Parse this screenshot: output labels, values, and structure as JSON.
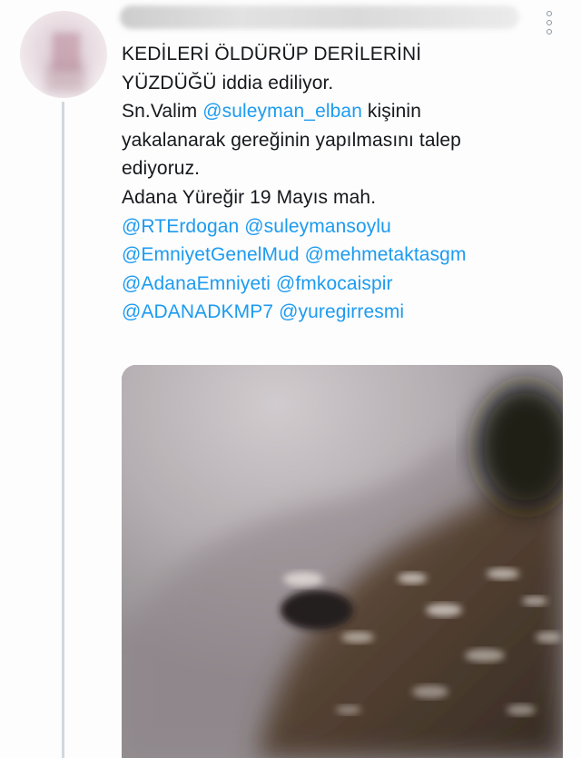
{
  "tweet": {
    "body_lines": [
      {
        "segments": [
          {
            "text": "KEDİLERİ ÖLDÜRÜP DERİLERİNİ",
            "mention": false
          }
        ]
      },
      {
        "segments": [
          {
            "text": "YÜZDÜĞÜ iddia ediliyor.",
            "mention": false
          }
        ]
      },
      {
        "segments": [
          {
            "text": "Sn.Valim ",
            "mention": false
          },
          {
            "text": "@suleyman_elban",
            "mention": true
          },
          {
            "text": " kişinin",
            "mention": false
          }
        ]
      },
      {
        "segments": [
          {
            "text": "yakalanarak gereğinin yapılmasını talep",
            "mention": false
          }
        ]
      },
      {
        "segments": [
          {
            "text": "ediyoruz.",
            "mention": false
          }
        ]
      },
      {
        "segments": [
          {
            "text": "Adana Yüreğir 19 Mayıs mah.",
            "mention": false
          }
        ]
      },
      {
        "segments": [
          {
            "text": "@RTErdogan",
            "mention": true
          },
          {
            "text": " ",
            "mention": false
          },
          {
            "text": "@suleymansoylu",
            "mention": true
          }
        ]
      },
      {
        "segments": [
          {
            "text": "@EmniyetGenelMud",
            "mention": true
          },
          {
            "text": " ",
            "mention": false
          },
          {
            "text": "@mehmetaktasgm",
            "mention": true
          }
        ]
      },
      {
        "segments": [
          {
            "text": "@AdanaEmniyeti",
            "mention": true
          },
          {
            "text": " ",
            "mention": false
          },
          {
            "text": "@fmkocaispir",
            "mention": true
          }
        ]
      },
      {
        "segments": [
          {
            "text": "@ADANADKMP7",
            "mention": true
          },
          {
            "text": " ",
            "mention": false
          },
          {
            "text": "@yuregirresmi",
            "mention": true
          }
        ]
      }
    ]
  },
  "colors": {
    "mention": "#1d9bf0",
    "text": "#16181c",
    "thread_line": "#cfd9de"
  },
  "icons": {
    "more": "more-vertical-icon"
  }
}
